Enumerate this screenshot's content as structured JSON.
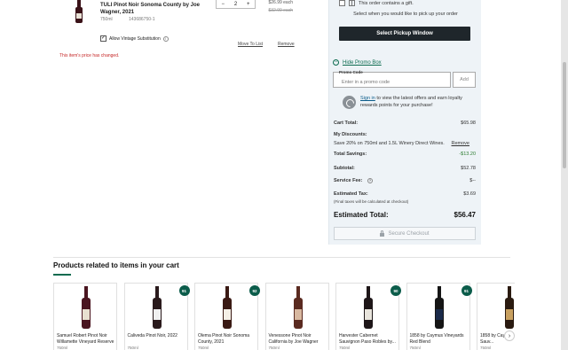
{
  "cart_item": {
    "name": "TULI Pinot Noir Sonoma County by Joe Wagner, 2021",
    "size": "750ml",
    "sku": "143686750-1",
    "quantity": "2",
    "price_each": "$26.99 each",
    "price_original": "$32.99 each",
    "vintage_label": "Allow Vintage Substitution",
    "vintage_checked": "✓",
    "move_label": "Move To List",
    "remove_label": "Remove",
    "price_changed_notice": "This item's price has changed.",
    "quantity_minus": "−",
    "quantity_plus": "+"
  },
  "summary": {
    "gift_label": "This order contains a gift.",
    "pickup_note": "Select when you would like to pick up your order",
    "pickup_button": "Select Pickup Window",
    "promo_toggle": "Hide Promo Box",
    "promo_label": "Promo Code",
    "promo_placeholder": "Enter in a promo code",
    "promo_add": "Add",
    "signin_link": "Sign in",
    "signin_text": " to view the latest offers and earn loyalty rewards points for your purchase!",
    "cart_total_label": "Cart Total:",
    "cart_total_value": "$65.98",
    "discounts_label": "My Discounts:",
    "discount_text": "Save 20% on 750ml and 1.5L Winery Direct Wines.",
    "discount_remove": "Remove",
    "savings_label": "Total Savings:",
    "savings_value": "-$13.20",
    "subtotal_label": "Subtotal:",
    "subtotal_value": "$52.78",
    "service_fee_label": "Service Fee:",
    "service_fee_value": "$--",
    "tax_label": "Estimated Tax:",
    "tax_value": "$3.69",
    "tax_note": "(Final taxes will be calculated at checkout)",
    "total_label": "Estimated Total:",
    "total_value": "$56.47",
    "checkout_button": "Secure Checkout"
  },
  "related": {
    "title": "Products related to items in your cart",
    "next_label": "›",
    "products": [
      {
        "name": "Samuel Robert Pinot Noir Willamette Vineyard Reserve",
        "size": "750ml",
        "badge": "",
        "bottle_color": "#4a1520",
        "label_color": "#e8e0d0"
      },
      {
        "name": "Caliveda Pinot Noir, 2022",
        "size": "750ml",
        "badge": "91",
        "bottle_color": "#2a1a1c",
        "label_color": "#f0f0f0"
      },
      {
        "name": "Olema Pinot Noir Sonoma County, 2021",
        "size": "750ml",
        "badge": "92",
        "bottle_color": "#3a1a14",
        "label_color": "#f4efe6"
      },
      {
        "name": "Venessone Pinot Noir California by Joe Wagner",
        "size": "750ml",
        "badge": "",
        "bottle_color": "#5a2a20",
        "label_color": "#d8b8a0"
      },
      {
        "name": "Harvester Cabernet Sauvignon Paso Robles by...",
        "size": "750ml",
        "badge": "90",
        "bottle_color": "#1e1618",
        "label_color": "#e8e4dc"
      },
      {
        "name": "1858 by Caymus Vineyards Red Blend",
        "size": "750ml",
        "badge": "91",
        "bottle_color": "#151515",
        "label_color": "#1a2a4a"
      },
      {
        "name": "1858 by Caymus Cabernet Sauv...",
        "size": "750ml",
        "badge": "",
        "bottle_color": "#2a1a10",
        "label_color": "#c8a060"
      }
    ]
  }
}
